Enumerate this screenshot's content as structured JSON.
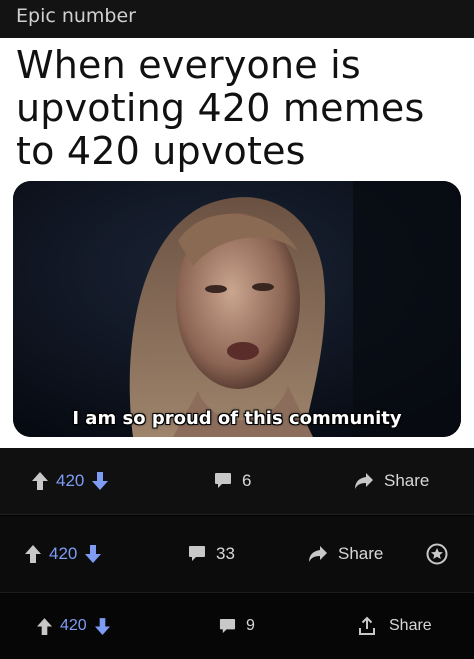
{
  "post": {
    "title": "Epic number"
  },
  "meme": {
    "caption_line1": "When everyone is",
    "caption_line2": "upvoting 420 memes",
    "caption_line3": "to 420 upvotes",
    "subtitle": "I am so proud of this community"
  },
  "action_bars": [
    {
      "votes": "420",
      "comments": "6",
      "share_label": "Share",
      "share_icon": "share-arrow-icon"
    },
    {
      "votes": "420",
      "comments": "33",
      "share_label": "Share",
      "share_icon": "share-arrow-icon",
      "extra_icon": "award-icon"
    },
    {
      "votes": "420",
      "comments": "9",
      "share_label": "Share",
      "share_icon": "share-upload-icon"
    }
  ],
  "colors": {
    "vote_blue": "#7f9cf5",
    "upvote_gray": "#c8c8c8",
    "text_gray": "#d7d7d7"
  }
}
